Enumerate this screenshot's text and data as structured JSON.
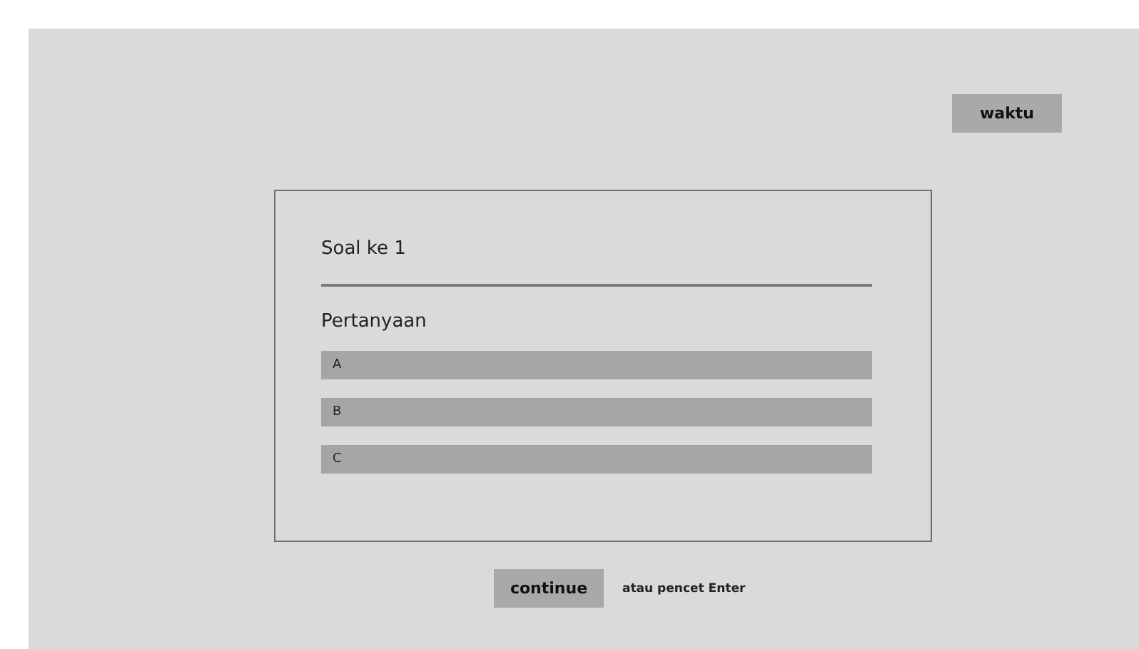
{
  "timer_button": {
    "label": "waktu"
  },
  "question_card": {
    "title": "Soal ke 1",
    "question": "Pertanyaan",
    "options": [
      {
        "label": "A"
      },
      {
        "label": "B"
      },
      {
        "label": "C"
      }
    ]
  },
  "continue_button": {
    "label": "continue"
  },
  "hint": "atau pencet Enter"
}
